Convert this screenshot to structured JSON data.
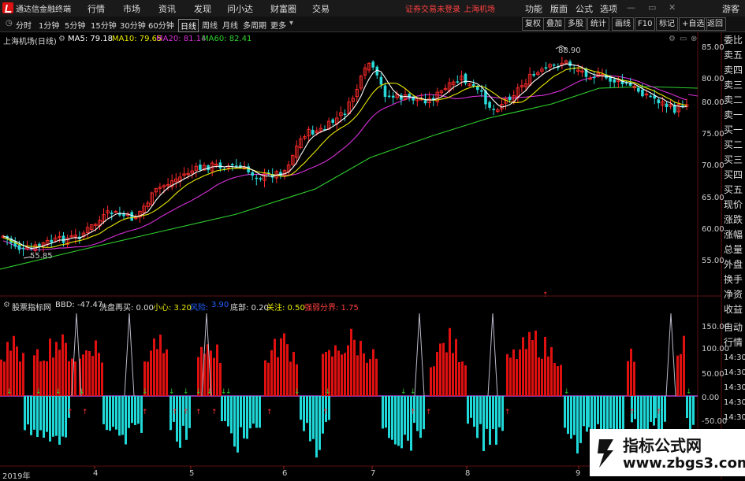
{
  "app": {
    "title": "通达信金融终端"
  },
  "menu": [
    "行情",
    "市场",
    "资讯",
    "发现",
    "问小达",
    "财富圈",
    "交易"
  ],
  "notice": {
    "text": "证券交易未登录",
    "market": "上海机场"
  },
  "right_menu": [
    "功能",
    "版面",
    "公式",
    "选项"
  ],
  "guest": "游客",
  "toolbar": {
    "periods": [
      "分时",
      "1分钟",
      "5分钟",
      "15分钟",
      "30分钟",
      "60分钟",
      "日线",
      "周线",
      "月线",
      "多周期",
      "更多"
    ],
    "active": "日线",
    "right": [
      "复权",
      "叠加",
      "多股",
      "统计",
      "画线",
      "F10",
      "标记",
      "+自选",
      "返回"
    ]
  },
  "main_legend": {
    "stock": "上海机场(日线)",
    "ma5": "MA5: 79.18",
    "ma10": "MA10: 79.65",
    "ma20": "MA20: 81.14",
    "ma60": "MA60: 82.41"
  },
  "sub_legend": {
    "name": "股票指标网",
    "bbd": "BBD: -47.47",
    "xpzm": "洗盘再买: 0.00",
    "xx": "小心: 3.20",
    "fx": "风险: ",
    "fx_v": "3.90",
    "db": "底部: 0.20",
    "gz": "关注: 0.50",
    "qr": "强弱分界: 1.75"
  },
  "price_axis": [
    "85.00",
    "80.00",
    "75.00",
    "70.00",
    "65.00",
    "60.00",
    "55.00"
  ],
  "sub_axis": [
    "150.00",
    "100.00",
    "50.00",
    "0.00",
    "-50.00"
  ],
  "annotations": {
    "high": "88.90",
    "low": "55.85"
  },
  "x_axis": [
    "2019年",
    "4",
    "5",
    "6",
    "7",
    "8",
    "9"
  ],
  "right_panel": [
    "委比",
    "卖五",
    "卖四",
    "卖三",
    "卖二",
    "卖一",
    "买一",
    "买二",
    "买三",
    "买四",
    "买五",
    "现价",
    "涨跌",
    "涨幅",
    "总量",
    "外盘",
    "换手",
    "净资",
    "收益"
  ],
  "right_panel2": [
    "自动",
    "行情",
    "14:30",
    "14:30",
    "14:30",
    "14:30",
    "14:30",
    "14:31",
    "14:31",
    "14:31"
  ],
  "watermark": {
    "line1": "指标公式网",
    "line2": "www.zbgs3.com"
  },
  "colors": {
    "up": "#ff2a2a",
    "down": "#2bd9d9",
    "ma5": "#ffffff",
    "ma10": "#e8e800",
    "ma20": "#d830d8",
    "ma60": "#30d030",
    "bar_up": "#e01010",
    "bar_down": "#20d8d8"
  }
}
